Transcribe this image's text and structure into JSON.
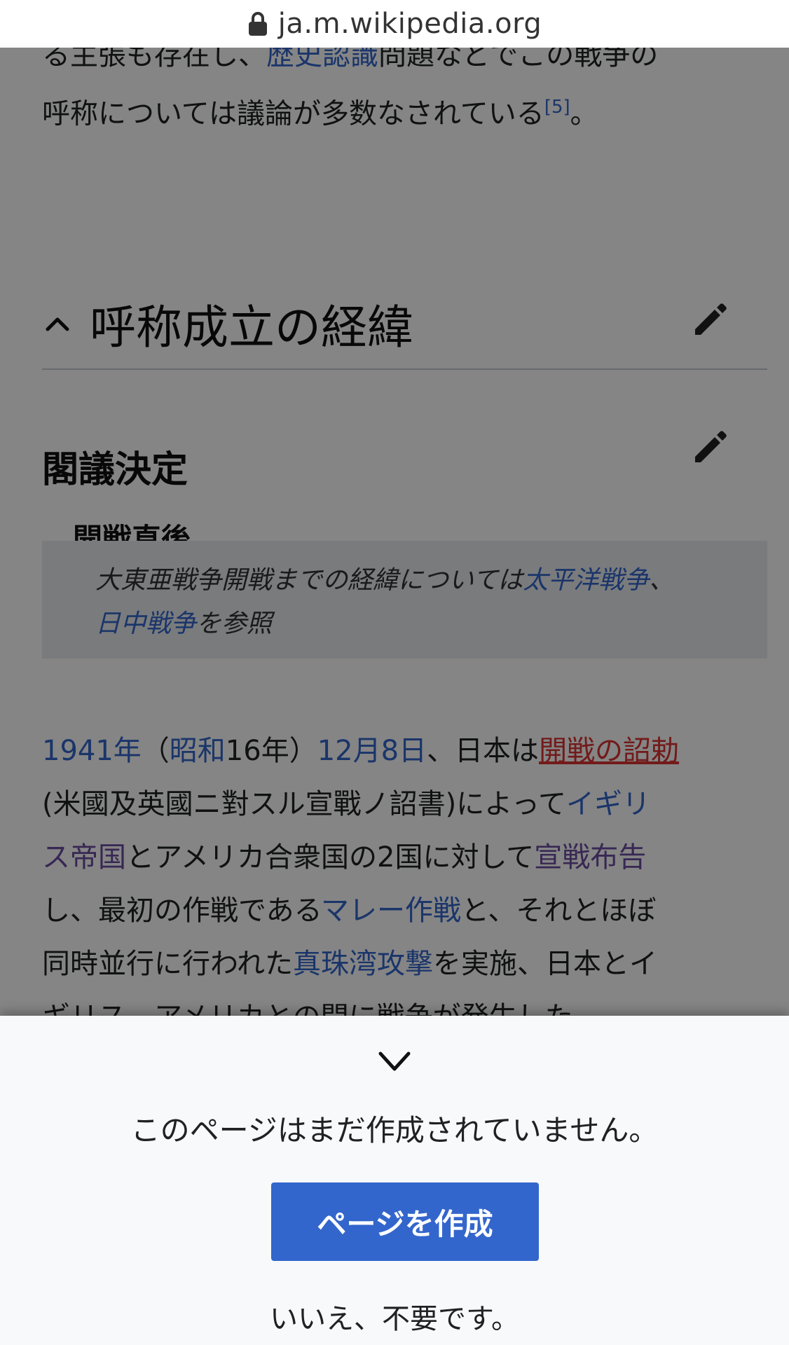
{
  "browser": {
    "url": "ja.m.wikipedia.org"
  },
  "article": {
    "intro": {
      "line1_pre": "る主張も存在し、",
      "line1_link": "歴史認識",
      "line1_post": "問題などでこの戦争の",
      "line2": "呼称については議論が多数なされている",
      "cite": "[5]",
      "line2_end": "。"
    },
    "section_heading": "呼称成立の経緯",
    "subsection_heading": "閣議決定",
    "subsubsection_heading": "開戦直後",
    "hatnote": {
      "text_pre": "大東亜戦争開戦までの経緯については",
      "link1": "太平洋戦争",
      "sep": "、",
      "link2": "日中戦争",
      "text_post": "を参照"
    },
    "paragraph": {
      "l1_link1": "1941年",
      "l1_t1": "（",
      "l1_link2": "昭和",
      "l1_t2": "16年）",
      "l1_link3": "12月8日",
      "l1_t3": "、日本は",
      "l1_redlink": "開戦の詔勅",
      "l2_t1": "(米國及英國ニ對スル宣戰ノ詔書)によって",
      "l2_link": "イギリ",
      "l3_link": "ス帝国",
      "l3_t1": "とアメリカ合衆国の2国に対して",
      "l3_link2": "宣戦布告",
      "l4_t1": "し、最初の作戦である",
      "l4_link": "マレー作戦",
      "l4_t2": "と、それとほぼ",
      "l5_t1": "同時並行に行われた",
      "l5_link": "真珠湾攻撃",
      "l5_t2": "を実施、日本とイ",
      "l6_t1": "ギリス、アメリカとの間に戦争が発生した。"
    }
  },
  "drawer": {
    "message": "このページはまだ作成されていません。",
    "create_button": "ページを作成",
    "decline": "いいえ、不要です。"
  },
  "icons": {
    "lock": "lock-icon",
    "chevron_up": "chevron-up-icon",
    "edit": "pencil-icon",
    "chevron_down": "chevron-down-icon"
  },
  "colors": {
    "link": "#3366cc",
    "visited_link": "#6b4ba1",
    "red_link": "#dd3333",
    "button": "#3366cc"
  }
}
